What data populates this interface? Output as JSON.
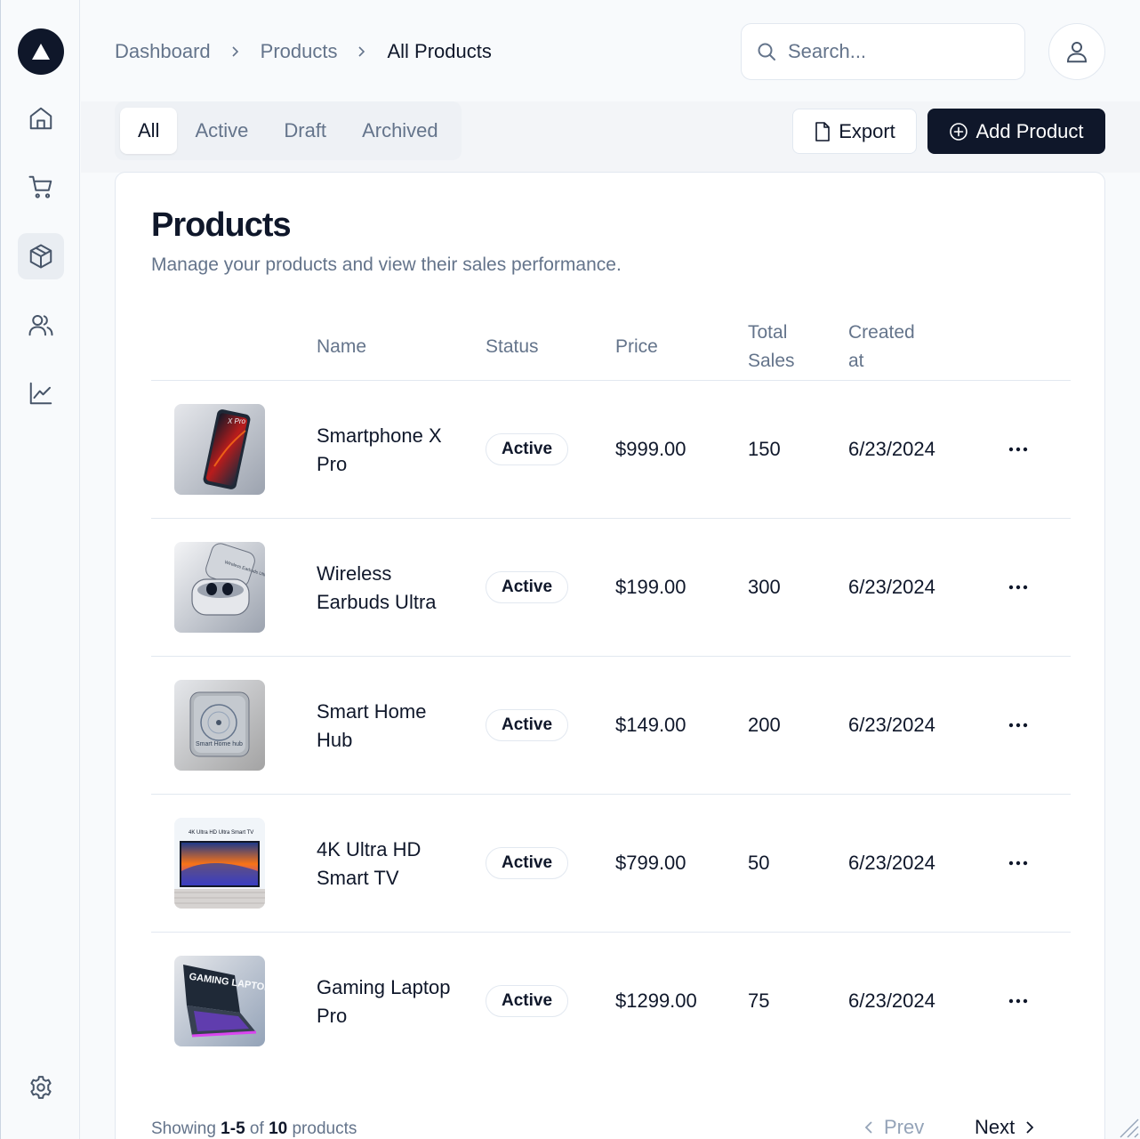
{
  "breadcrumb": {
    "items": [
      "Dashboard",
      "Products"
    ],
    "current": "All Products"
  },
  "search": {
    "placeholder": "Search..."
  },
  "tabs": [
    {
      "label": "All",
      "active": true
    },
    {
      "label": "Active",
      "active": false
    },
    {
      "label": "Draft",
      "active": false
    },
    {
      "label": "Archived",
      "active": false
    }
  ],
  "actions": {
    "export_label": "Export",
    "add_label": "Add Product"
  },
  "card": {
    "title": "Products",
    "description": "Manage your products and view their sales performance."
  },
  "table": {
    "headers": {
      "name": "Name",
      "status": "Status",
      "price": "Price",
      "sales_1": "Total",
      "sales_2": "Sales",
      "created_1": "Created",
      "created_2": "at"
    },
    "rows": [
      {
        "name": "Smartphone X Pro",
        "status": "Active",
        "price": "$999.00",
        "sales": "150",
        "created": "6/23/2024",
        "image_label": "X Pro"
      },
      {
        "name": "Wireless Earbuds Ultra",
        "status": "Active",
        "price": "$199.00",
        "sales": "300",
        "created": "6/23/2024",
        "image_label": "Wireless Earbuds Ultra"
      },
      {
        "name": "Smart Home Hub",
        "status": "Active",
        "price": "$149.00",
        "sales": "200",
        "created": "6/23/2024",
        "image_label": "Smart Home hub"
      },
      {
        "name": "4K Ultra HD Smart TV",
        "status": "Active",
        "price": "$799.00",
        "sales": "50",
        "created": "6/23/2024",
        "image_label": "4K Ultra HD Ultra Smart TV"
      },
      {
        "name": "Gaming Laptop Pro",
        "status": "Active",
        "price": "$1299.00",
        "sales": "75",
        "created": "6/23/2024",
        "image_label": "GAMING LAPTOP PRO"
      }
    ]
  },
  "footer": {
    "showing": "Showing",
    "range": "1-5",
    "of": "of",
    "total": "10",
    "suffix": "products"
  },
  "pager": {
    "prev_label": "Prev",
    "next_label": "Next"
  },
  "colors": {
    "primary": "#0f172a",
    "muted": "#64748b",
    "border": "#e2e8f0",
    "background": "#f8fafc"
  },
  "icons": [
    "logo-icon",
    "home-icon",
    "cart-icon",
    "package-icon",
    "users-icon",
    "chart-icon",
    "settings-icon",
    "search-icon",
    "user-icon",
    "file-icon",
    "plus-circle-icon",
    "more-icon",
    "chevron-left-icon",
    "chevron-right-icon"
  ]
}
